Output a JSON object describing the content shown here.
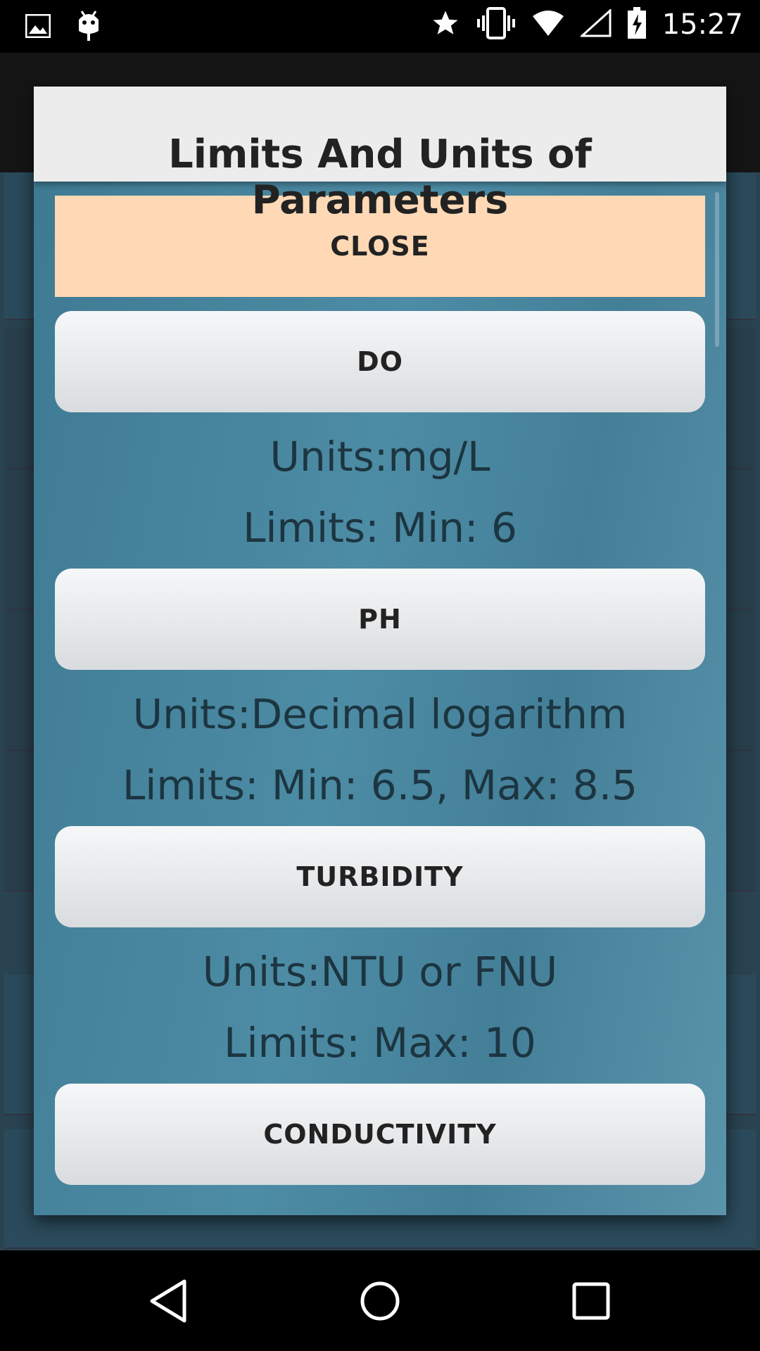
{
  "status_bar": {
    "time": "15:27",
    "icons": [
      "image-icon",
      "android-debug-icon",
      "star-icon",
      "vibrate-icon",
      "wifi-icon",
      "cell-signal-icon",
      "battery-charging-icon"
    ]
  },
  "dialog": {
    "title": "Limits And Units of Parameters",
    "close_label": "CLOSE",
    "parameters": [
      {
        "label": "DO",
        "units": "Units:mg/L",
        "limits": "Limits: Min: 6"
      },
      {
        "label": "PH",
        "units": "Units:Decimal logarithm",
        "limits": "Limits: Min: 6.5, Max: 8.5"
      },
      {
        "label": "TURBIDITY",
        "units": "Units:NTU or FNU",
        "limits": "Limits: Max: 10"
      },
      {
        "label": "CONDUCTIVITY"
      }
    ]
  },
  "nav_bar": {
    "icons": [
      "back-icon",
      "home-icon",
      "recents-icon"
    ]
  },
  "colors": {
    "close_button": "#ffd9b5",
    "dialog_body": "#4f8aa3",
    "header": "#ececec"
  }
}
